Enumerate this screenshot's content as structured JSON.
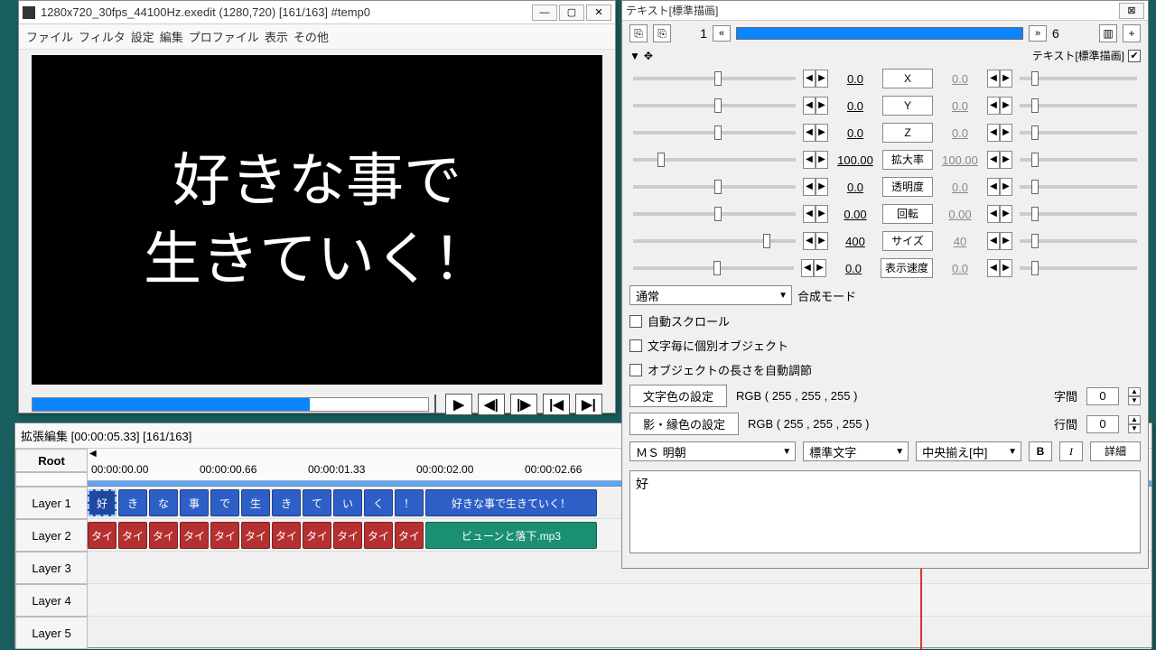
{
  "main": {
    "title": "1280x720_30fps_44100Hz.exedit (1280,720) [161/163]  #temp0",
    "menu": [
      "ファイル",
      "フィルタ",
      "設定",
      "編集",
      "プロファイル",
      "表示",
      "その他"
    ],
    "preview_line1": "好きな事で",
    "preview_line2": "生きていく！",
    "transport": {
      "play": "▶",
      "step_back": "◀|",
      "step_fwd": "|▶",
      "first": "|◀",
      "last": "▶|"
    }
  },
  "timeline": {
    "title": "拡張編集 [00:00:05.33] [161/163]",
    "root": "Root",
    "times": [
      "00:00:00.00",
      "00:00:00.66",
      "00:00:01.33",
      "00:00:02.00",
      "00:00:02.66"
    ],
    "layers": [
      "Layer 1",
      "Layer 2",
      "Layer 3",
      "Layer 4",
      "Layer 5"
    ],
    "l1_chars": [
      "好",
      "き",
      "な",
      "事",
      "で",
      "生",
      "き",
      "て",
      "い",
      "く",
      "！"
    ],
    "l1_tail": "好きな事で生きていく！",
    "l2_item": "タイ",
    "l2_tail": "ビューンと落下.mp3"
  },
  "prop": {
    "title": "テキスト[標準描画]",
    "frame_cur": "1",
    "frame_end": "6",
    "badge": "テキスト[標準描画]",
    "params": [
      {
        "label": "X",
        "v": "0.0",
        "v2": "0.0"
      },
      {
        "label": "Y",
        "v": "0.0",
        "v2": "0.0"
      },
      {
        "label": "Z",
        "v": "0.0",
        "v2": "0.0"
      },
      {
        "label": "拡大率",
        "v": "100.00",
        "v2": "100.00"
      },
      {
        "label": "透明度",
        "v": "0.0",
        "v2": "0.0"
      },
      {
        "label": "回転",
        "v": "0.00",
        "v2": "0.00"
      },
      {
        "label": "サイズ",
        "v": "400",
        "v2": "40"
      },
      {
        "label": "表示速度",
        "v": "0.0",
        "v2": "0.0"
      }
    ],
    "blend_label": "合成モード",
    "blend": "通常",
    "checks": [
      "自動スクロール",
      "文字毎に個別オブジェクト",
      "オブジェクトの長さを自動調節"
    ],
    "txtcolor_btn": "文字色の設定",
    "txtcolor_val": "RGB ( 255 , 255 , 255 )",
    "shadow_btn": "影・縁色の設定",
    "shadow_val": "RGB ( 255 , 255 , 255 )",
    "spacing_label": "字間",
    "spacing_val": "0",
    "leading_label": "行間",
    "leading_val": "0",
    "font": "ＭＳ 明朝",
    "style": "標準文字",
    "align": "中央揃え[中]",
    "b": "B",
    "i": "I",
    "detail": "詳細",
    "text_value": "好"
  }
}
